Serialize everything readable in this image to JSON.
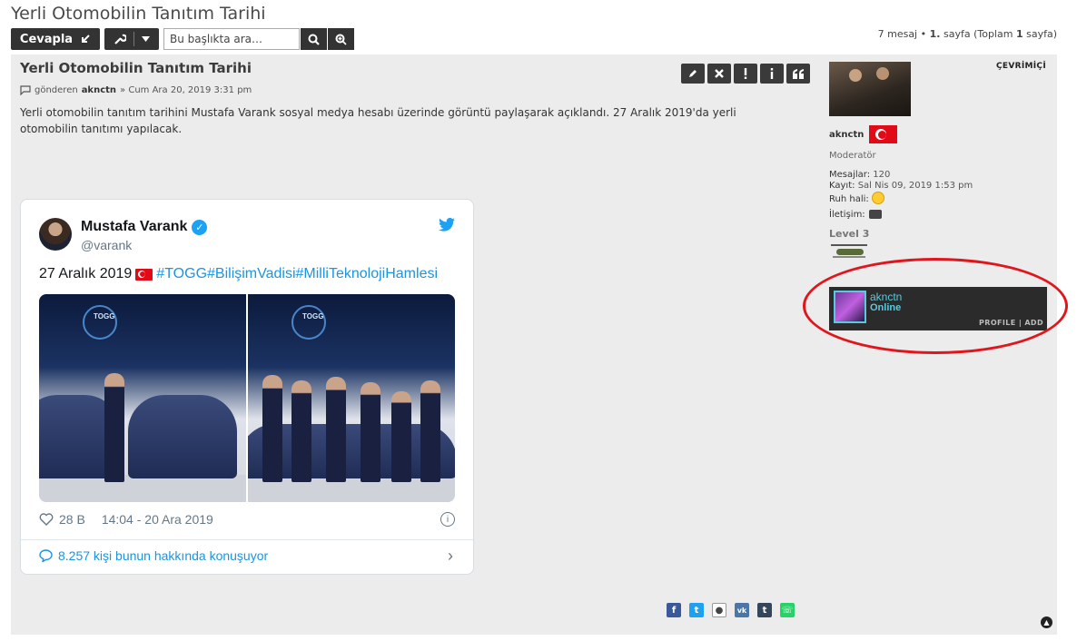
{
  "topic": {
    "title": "Yerli Otomobilin Tanıtım Tarihi"
  },
  "toolbar": {
    "reply_label": "Cevapla",
    "search_placeholder": "Bu başlıkta ara…"
  },
  "pagination": {
    "messages": "7 mesaj",
    "bullet": "•",
    "page": "1.",
    "page_word": "sayfa",
    "total_prefix": "(Toplam",
    "total": "1",
    "total_suffix": "sayfa)"
  },
  "post": {
    "title": "Yerli Otomobilin Tanıtım Tarihi",
    "meta_prefix": "gönderen",
    "author": "aknctn",
    "date": "» Cum Ara 20, 2019 3:31 pm",
    "text": "Yerli otomobilin tanıtım tarihini Mustafa Varank sosyal medya hesabı üzerinde görüntü paylaşarak açıklandı. 27 Aralık 2019'da yerli otomobilin tanıtımı yapılacak."
  },
  "tweet": {
    "name": "Mustafa Varank",
    "handle": "@varank",
    "date_text": "27 Aralık 2019",
    "hashtags": "#TOGG#BilişimVadisi#MilliTeknolojiHamlesi",
    "likes": "28 B",
    "timestamp": "14:04 - 20 Ara 2019",
    "talk": "8.257 kişi bunun hakkında konuşuyor",
    "photo_logo": "TOGG"
  },
  "profile": {
    "status": "ÇEVRİMİÇİ",
    "username": "aknctn",
    "rank": "Moderatör",
    "messages_label": "Mesajlar:",
    "messages": "120",
    "joined_label": "Kayıt:",
    "joined": "Sal Nis 09, 2019 1:53 pm",
    "mood_label": "Ruh hali:",
    "contact_label": "İletişim:",
    "level": "Level 3"
  },
  "steam": {
    "name": "aknctn",
    "status": "Online",
    "links": "PROFILE | ADD"
  },
  "colors": {
    "dark_button": "#333333",
    "post_bg": "#ececec",
    "twitter_blue": "#1da1f2",
    "link_blue": "#1b95e0",
    "annotation_red": "#e0161c"
  }
}
